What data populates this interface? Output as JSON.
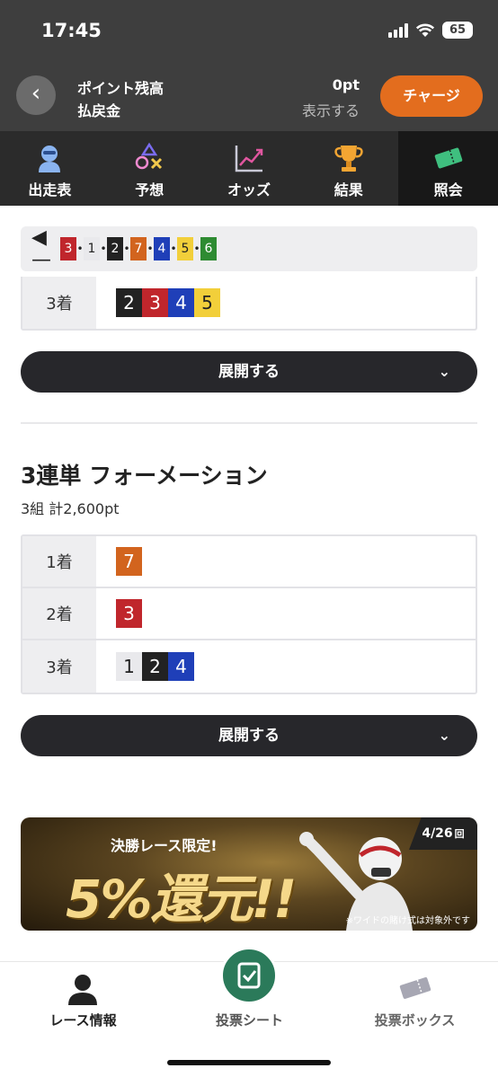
{
  "status": {
    "time": "17:45",
    "battery": "65"
  },
  "header": {
    "point_label": "ポイント残高",
    "payout_label": "払戻金",
    "point_value": "0pt",
    "payout_value": "表示する",
    "charge_label": "チャージ"
  },
  "tabs": [
    {
      "label": "出走表",
      "icon": "helmet-icon"
    },
    {
      "label": "予想",
      "icon": "shapes-icon"
    },
    {
      "label": "オッズ",
      "icon": "chart-icon"
    },
    {
      "label": "結果",
      "icon": "trophy-icon"
    },
    {
      "label": "照会",
      "icon": "ticket-icon",
      "active": true
    }
  ],
  "colors": {
    "accent": "#e36d1e",
    "dark": "#3e3e3e",
    "green": "#2b7a5a"
  },
  "order_bar": [
    {
      "num": "3",
      "color": "#c0262c",
      "text": "#ffffff"
    },
    {
      "num": "1",
      "color": "#e9e9ec",
      "text": "#222222"
    },
    {
      "num": "2",
      "color": "#222222",
      "text": "#ffffff"
    },
    {
      "num": "7",
      "color": "#d2641e",
      "text": "#ffffff"
    },
    {
      "num": "4",
      "color": "#1f3fb8",
      "text": "#ffffff"
    },
    {
      "num": "5",
      "color": "#f2cf3a",
      "text": "#222222"
    },
    {
      "num": "6",
      "color": "#2e8b32",
      "text": "#ffffff"
    }
  ],
  "first_table": {
    "rows": [
      {
        "label": "3着",
        "nums": [
          {
            "num": "2",
            "color": "#222222",
            "text": "#ffffff"
          },
          {
            "num": "3",
            "color": "#c0262c",
            "text": "#ffffff"
          },
          {
            "num": "4",
            "color": "#1f3fb8",
            "text": "#ffffff"
          },
          {
            "num": "5",
            "color": "#f2cf3a",
            "text": "#222222"
          }
        ]
      }
    ]
  },
  "expand_label": "展開する",
  "section": {
    "title": "3連単 フォーメーション",
    "subtitle": "3組 計2,600pt"
  },
  "second_table": {
    "rows": [
      {
        "label": "1着",
        "nums": [
          {
            "num": "7",
            "color": "#d2641e",
            "text": "#ffffff"
          }
        ]
      },
      {
        "label": "2着",
        "nums": [
          {
            "num": "3",
            "color": "#c0262c",
            "text": "#ffffff"
          }
        ]
      },
      {
        "label": "3着",
        "nums": [
          {
            "num": "1",
            "color": "#e9e9ec",
            "text": "#222222"
          },
          {
            "num": "2",
            "color": "#222222",
            "text": "#ffffff"
          },
          {
            "num": "4",
            "color": "#1f3fb8",
            "text": "#ffffff"
          }
        ]
      }
    ]
  },
  "banner": {
    "headline": "決勝レース限定!",
    "main": "5%還元!!",
    "date": "4/26",
    "date_suffix": "回",
    "note": "※ワイドの賭け式は対象外です"
  },
  "bottom_nav": [
    {
      "label": "レース情報",
      "icon": "person-icon"
    },
    {
      "label": "投票シート",
      "icon": "check-sheet-icon"
    },
    {
      "label": "投票ボックス",
      "icon": "tickets-icon"
    }
  ]
}
